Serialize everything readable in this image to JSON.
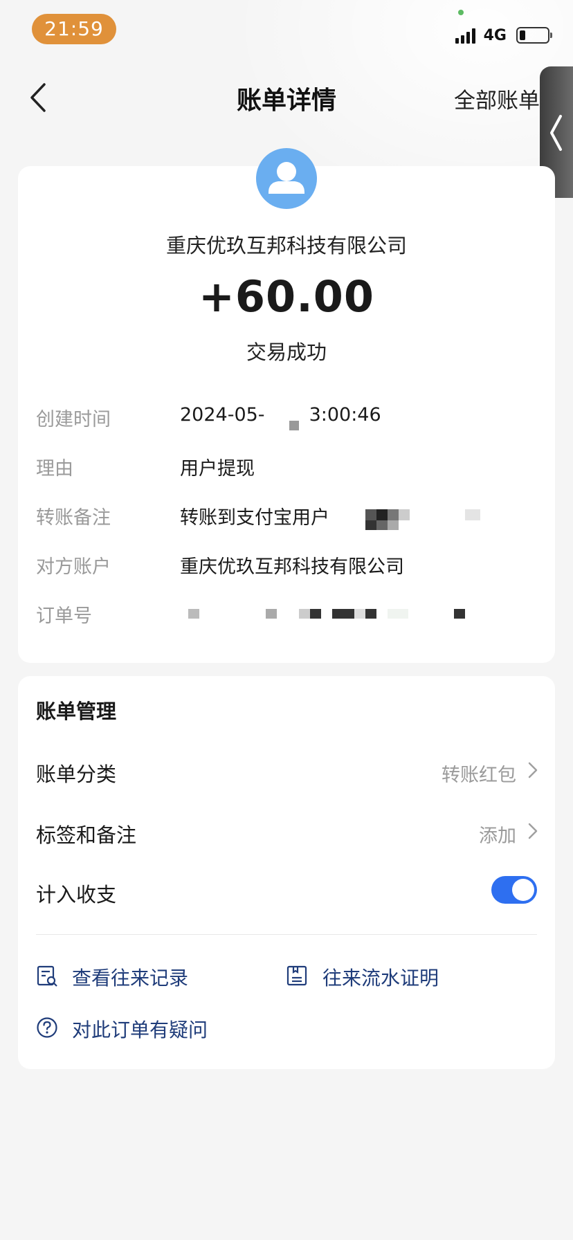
{
  "status_bar": {
    "time": "21:59",
    "network": "4G"
  },
  "nav": {
    "title": "账单详情",
    "right_label": "全部账单"
  },
  "transaction": {
    "payee_name": "重庆优玖互邦科技有限公司",
    "amount": "+60.00",
    "status": "交易成功"
  },
  "details": [
    {
      "label": "创建时间",
      "value": "2024-05-",
      "value_tail": "3:00:46"
    },
    {
      "label": "理由",
      "value": "用户提现"
    },
    {
      "label": "转账备注",
      "value": "转账到支付宝用户"
    },
    {
      "label": "对方账户",
      "value": "重庆优玖互邦科技有限公司"
    },
    {
      "label": "订单号",
      "value": ""
    }
  ],
  "management": {
    "title": "账单管理",
    "category": {
      "label": "账单分类",
      "value": "转账红包"
    },
    "tags": {
      "label": "标签和备注",
      "value": "添加"
    },
    "include": {
      "label": "计入收支",
      "enabled": true
    }
  },
  "links": {
    "records": "查看往来记录",
    "proof": "往来流水证明",
    "question": "对此订单有疑问"
  },
  "colors": {
    "accent": "#2e6ff0",
    "link": "#1f3c7a",
    "avatar": "#6aaef0",
    "time_pill": "#e0913a"
  }
}
